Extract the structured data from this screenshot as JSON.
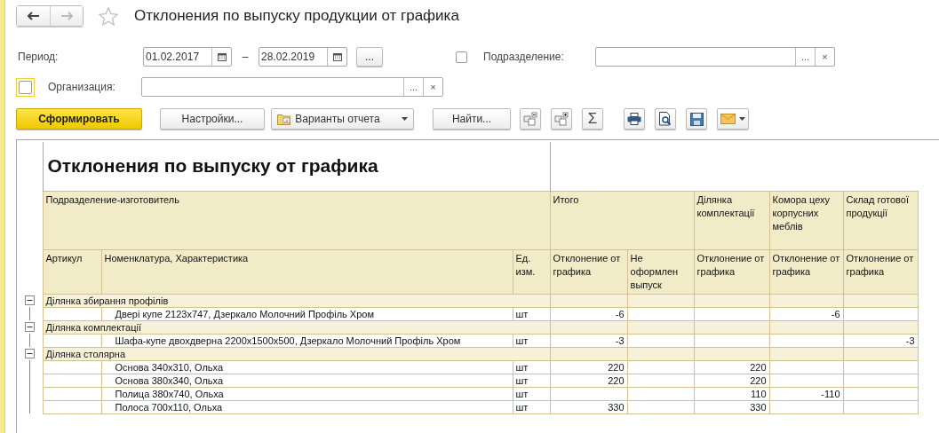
{
  "window": {
    "title": "Отклонения по выпуску продукции от графика",
    "back_disabled": false,
    "forward_disabled": true,
    "favorite": false
  },
  "period": {
    "label": "Период:",
    "from": "01.02.2017",
    "separator": "–",
    "to": "28.02.2019",
    "choose_button": "..."
  },
  "subdivision": {
    "checked": false,
    "label": "Подразделение:",
    "select_button": "...",
    "clear_button": "×"
  },
  "organization": {
    "checked": false,
    "focused": true,
    "label": "Организация:",
    "select_button": "...",
    "clear_button": "×"
  },
  "toolbar": {
    "generate": "Сформировать",
    "settings": "Настройки...",
    "variants": "Варианты отчета",
    "find": "Найти...",
    "sum": "Σ"
  },
  "report": {
    "title": "Отклонения по выпуску от графика",
    "header_top": [
      "Подразделение-изготовитель",
      "Итого",
      "Ділянка комплектації",
      "Комора цеху корпусних меблів",
      "Склад готової продукції"
    ],
    "header_bottom": [
      "Артикул",
      "Номенклатура, Характеристика",
      "Ед. изм.",
      "Отклонение от графика",
      "Не оформлен выпуск",
      "Отклонение от графика",
      "Отклонение от графика",
      "Отклонение от графика"
    ],
    "groups": [
      {
        "name": "Ділянка збирання профілів",
        "expanded": true,
        "items": [
          {
            "name": "Двері купе 2123х747, Дзеркало Молочний Профіль Хром",
            "unit": "шт",
            "values": {
              "total": "-6",
              "workshop_storage": "-6"
            }
          }
        ]
      },
      {
        "name": "Ділянка комплектації",
        "expanded": true,
        "items": [
          {
            "name": "Шафа-купе двохдверна 2200х1500х500, Дзеркало Молочний Профіль Хром",
            "unit": "шт",
            "values": {
              "total": "-3",
              "finished_goods": "-3"
            }
          }
        ]
      },
      {
        "name": "Ділянка столярна",
        "expanded": true,
        "items": [
          {
            "name": "Основа 340х310, Ольха",
            "unit": "шт",
            "values": {
              "total": "220",
              "assembly": "220"
            }
          },
          {
            "name": "Основа 380х340, Ольха",
            "unit": "шт",
            "values": {
              "total": "220",
              "assembly": "220"
            }
          },
          {
            "name": "Полица 380х740, Ольха",
            "unit": "шт",
            "values": {
              "assembly": "110",
              "workshop_storage": "-110"
            }
          },
          {
            "name": "Полоса 700х110, Ольха",
            "unit": "шт",
            "values": {
              "total": "330",
              "assembly": "330"
            }
          }
        ]
      }
    ]
  }
}
